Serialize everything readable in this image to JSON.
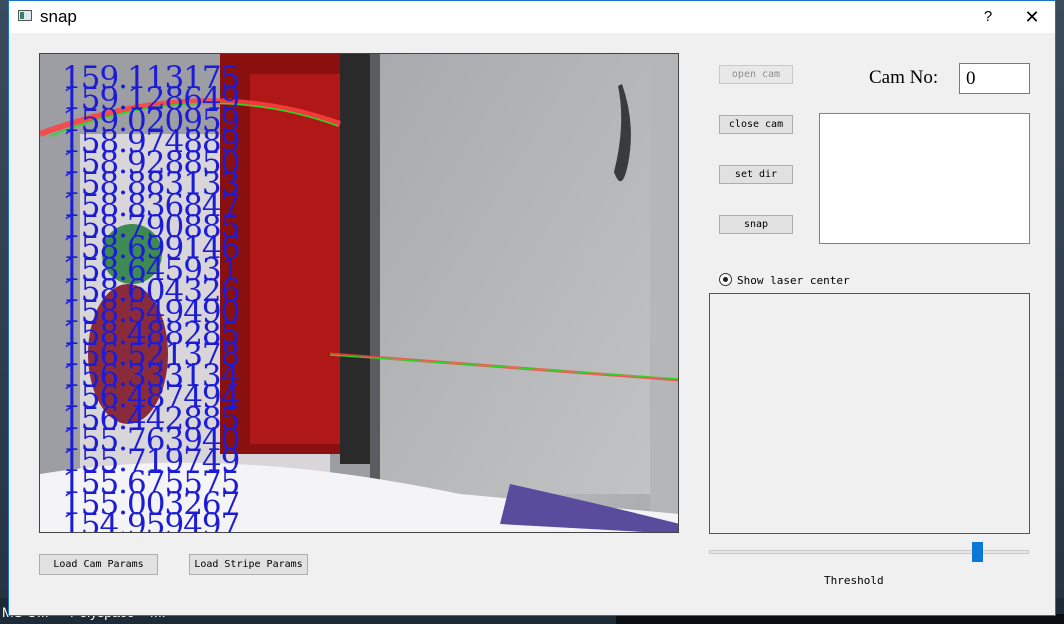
{
  "desktop": {
    "labels": [
      "MS U...",
      "Polyspace",
      "MI"
    ]
  },
  "window": {
    "title": "snap",
    "help_label": "?",
    "close_label": "✕"
  },
  "video": {
    "readings": [
      "159.113175",
      "159.128649",
      "159.020959",
      "158.974889",
      "158.928850",
      "158.883133",
      "158.836847",
      "158.790885",
      "158.699146",
      "158.645931",
      "158.604326",
      "158.549490",
      "158.488285",
      "156.521378",
      "156.333134",
      "156.487494",
      "156.442885",
      "155.763940",
      "155.719749",
      "155.675575",
      "155.003267",
      "154.959497",
      "154.915751"
    ]
  },
  "buttons": {
    "open_cam": "open cam",
    "close_cam": "close cam",
    "set_dir": "set dir",
    "snap": "snap",
    "load_cam_params": "Load Cam Params",
    "load_stripe_params": "Load Stripe Params"
  },
  "cam": {
    "label": "Cam No:",
    "value": "0"
  },
  "show_laser": {
    "label": "Show laser center",
    "checked": true
  },
  "threshold": {
    "label": "Threshold",
    "value": 0.85
  },
  "colors": {
    "accent": "#0a78d7",
    "reading_text": "#1c1cd8",
    "laser_red": "#ff4040",
    "laser_green": "#22dd22"
  }
}
